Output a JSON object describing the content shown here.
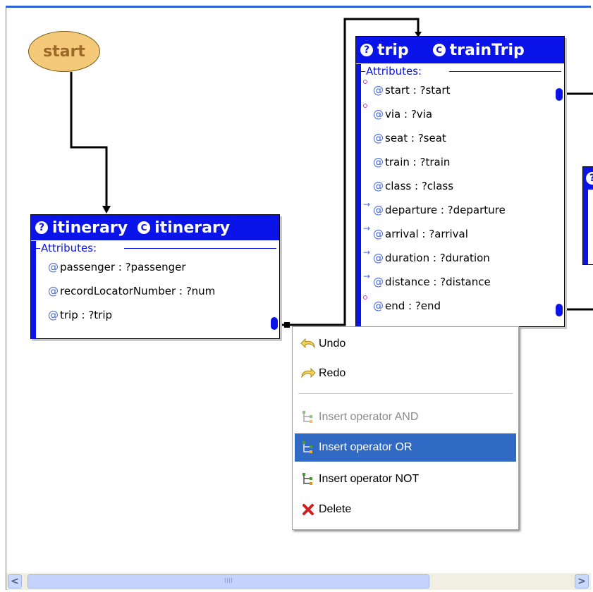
{
  "start_node": {
    "label": "start"
  },
  "itinerary_node": {
    "var_name": "itinerary",
    "class_name": "itinerary",
    "q_icon": "?",
    "c_icon": "C",
    "attrs_title": "Attributes:",
    "attributes": [
      {
        "icon": "@",
        "text": "passenger : ?passenger"
      },
      {
        "icon": "@",
        "text": "recordLocatorNumber : ?num"
      },
      {
        "icon": "@",
        "text": "trip : ?trip"
      }
    ]
  },
  "trip_node": {
    "var_name": "trip",
    "class_name": "trainTrip",
    "q_icon": "?",
    "c_icon": "C",
    "attrs_title": "Attributes:",
    "attributes": [
      {
        "icon": "@",
        "text": "start : ?start",
        "marker": "circle"
      },
      {
        "icon": "@",
        "text": "via : ?via",
        "marker": "circle"
      },
      {
        "icon": "@",
        "text": "seat : ?seat",
        "marker": ""
      },
      {
        "icon": "@",
        "text": "train : ?train",
        "marker": ""
      },
      {
        "icon": "@",
        "text": "class : ?class",
        "marker": ""
      },
      {
        "icon": "@",
        "text": "departure : ?departure",
        "marker": "arrow"
      },
      {
        "icon": "@",
        "text": "arrival : ?arrival",
        "marker": "arrow"
      },
      {
        "icon": "@",
        "text": "duration : ?duration",
        "marker": "arrow"
      },
      {
        "icon": "@",
        "text": "distance : ?distance",
        "marker": "arrow"
      },
      {
        "icon": "@",
        "text": "end : ?end",
        "marker": "circle"
      }
    ]
  },
  "partial_node": {
    "q_icon": "?"
  },
  "context_menu": {
    "items": [
      {
        "label": "Undo",
        "icon": "undo-arrow-icon",
        "state": "normal"
      },
      {
        "label": "Redo",
        "icon": "redo-arrow-icon",
        "state": "normal"
      },
      {
        "label": "Insert operator AND",
        "icon": "tree-operator-icon",
        "state": "disabled"
      },
      {
        "label": "Insert operator OR",
        "icon": "tree-operator-icon",
        "state": "selected"
      },
      {
        "label": "Insert operator NOT",
        "icon": "tree-operator-icon",
        "state": "normal"
      },
      {
        "label": "Delete",
        "icon": "red-x-icon",
        "state": "normal"
      }
    ]
  },
  "scrollbar": {
    "left_arrow": "<",
    "right_arrow": ">",
    "grip": "IIII"
  },
  "colors": {
    "node_header": "#0a14e8",
    "menu_highlight": "#316ac5",
    "start_fill": "#f4c97a"
  }
}
